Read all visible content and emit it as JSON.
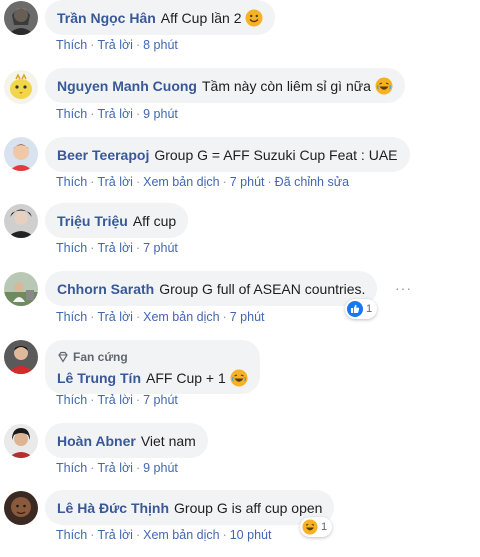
{
  "actions": {
    "like": "Thích",
    "reply": "Trả lời",
    "translate": "Xem bản dịch",
    "edited": "Đã chỉnh sửa",
    "sep": "·"
  },
  "comments": [
    {
      "author": "Trần Ngọc Hân",
      "text": "Aff Cup lần 2",
      "emoji": "smile",
      "time": "8 phút"
    },
    {
      "author": "Nguyen Manh Cuong",
      "text": "Tầm này còn liêm sỉ gì nữa",
      "emoji": "laugh",
      "time": "9 phút"
    },
    {
      "author": "Beer Teerapoj",
      "text": "Group G = AFF Suzuki Cup Feat : UAE",
      "time": "7 phút",
      "translate": true,
      "edited": true
    },
    {
      "author": "Triệu Triệu",
      "text": "Aff cup",
      "time": "7 phút"
    },
    {
      "author": "Chhorn Sarath",
      "text": "Group G full of ASEAN countries.",
      "time": "7 phút",
      "translate": true,
      "reaction": {
        "type": "like",
        "count": "1"
      },
      "more": "···"
    },
    {
      "author": "Lê Trung Tín",
      "badge": "Fan cứng",
      "text": "AFF Cup + 1",
      "emoji": "laugh",
      "time": "7 phút"
    },
    {
      "author": "Hoàn Abner",
      "text": "Viet nam",
      "time": "9 phút"
    },
    {
      "author": "Lê Hà Đức Thịnh",
      "text": "Group G is aff cup open",
      "time": "10 phút",
      "translate": true,
      "reaction": {
        "type": "haha",
        "count": "1"
      }
    }
  ],
  "colors": {
    "author": "#385898",
    "link": "#4267b2",
    "bubble": "#f2f3f5",
    "muted": "#606770",
    "like": "#1877f2",
    "emoji": "#f7b125"
  }
}
